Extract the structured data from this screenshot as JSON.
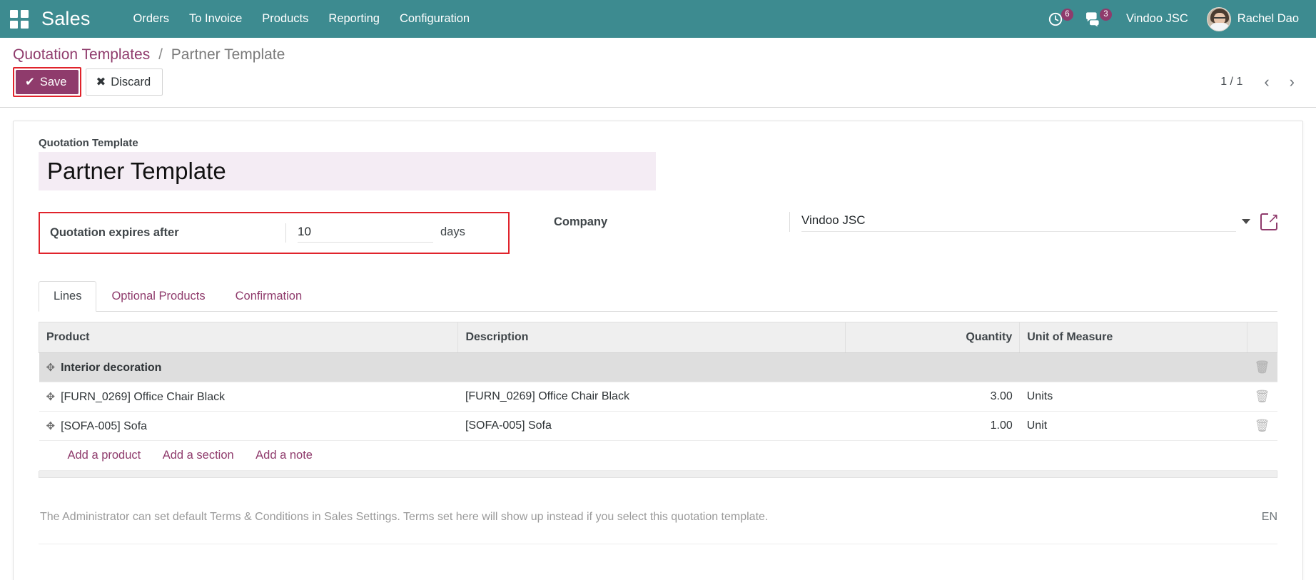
{
  "navbar": {
    "apps_icon": "apps-grid-icon",
    "brand": "Sales",
    "menu": [
      {
        "label": "Orders"
      },
      {
        "label": "To Invoice"
      },
      {
        "label": "Products"
      },
      {
        "label": "Reporting"
      },
      {
        "label": "Configuration"
      }
    ],
    "activity": {
      "icon": "clock-activity-icon",
      "count": "6"
    },
    "messages": {
      "icon": "chat-bubble-icon",
      "count": "3"
    },
    "company": "Vindoo JSC",
    "user": "Rachel Dao",
    "avatar_icon": "user-avatar"
  },
  "control_panel": {
    "breadcrumb_root": "Quotation Templates",
    "breadcrumb_sep": "/",
    "breadcrumb_current": "Partner Template",
    "save_label": "Save",
    "save_icon": "check-icon",
    "discard_label": "Discard",
    "discard_icon": "cross-icon",
    "pager_count": "1 / 1",
    "pager_prev_icon": "chevron-left-icon",
    "pager_next_icon": "chevron-right-icon",
    "highlight_color": "#e0232b",
    "accent_color": "#8f3b6c"
  },
  "form": {
    "title_label": "Quotation Template",
    "title_value": "Partner Template",
    "expires_label": "Quotation expires after",
    "expires_value": "10",
    "expires_unit": "days",
    "company_label": "Company",
    "company_value": "Vindoo JSC",
    "company_dropdown_icon": "chevron-down-icon",
    "company_external_icon": "external-link-icon"
  },
  "notebook": {
    "tabs": [
      {
        "label": "Lines",
        "active": true
      },
      {
        "label": "Optional Products",
        "active": false
      },
      {
        "label": "Confirmation",
        "active": false
      }
    ]
  },
  "lines": {
    "headers": {
      "product": "Product",
      "description": "Description",
      "quantity": "Quantity",
      "uom": "Unit of Measure"
    },
    "rows": [
      {
        "type": "section",
        "product": "Interior decoration",
        "description": "",
        "quantity": "",
        "uom": "",
        "handle_icon": "drag-handle-icon",
        "trash_icon": "trash-icon"
      },
      {
        "type": "product",
        "product": "[FURN_0269] Office Chair Black",
        "description": "[FURN_0269] Office Chair Black",
        "quantity": "3.00",
        "uom": "Units",
        "handle_icon": "drag-handle-icon",
        "trash_icon": "trash-icon"
      },
      {
        "type": "product",
        "product": "[SOFA-005] Sofa",
        "description": "[SOFA-005] Sofa",
        "quantity": "1.00",
        "uom": "Unit",
        "handle_icon": "drag-handle-icon",
        "trash_icon": "trash-icon"
      }
    ],
    "add_product": "Add a product",
    "add_section": "Add a section",
    "add_note": "Add a note"
  },
  "terms": {
    "text": "The Administrator can set default Terms & Conditions in Sales Settings. Terms set here will show up instead if you select this quotation template.",
    "language": "EN"
  }
}
